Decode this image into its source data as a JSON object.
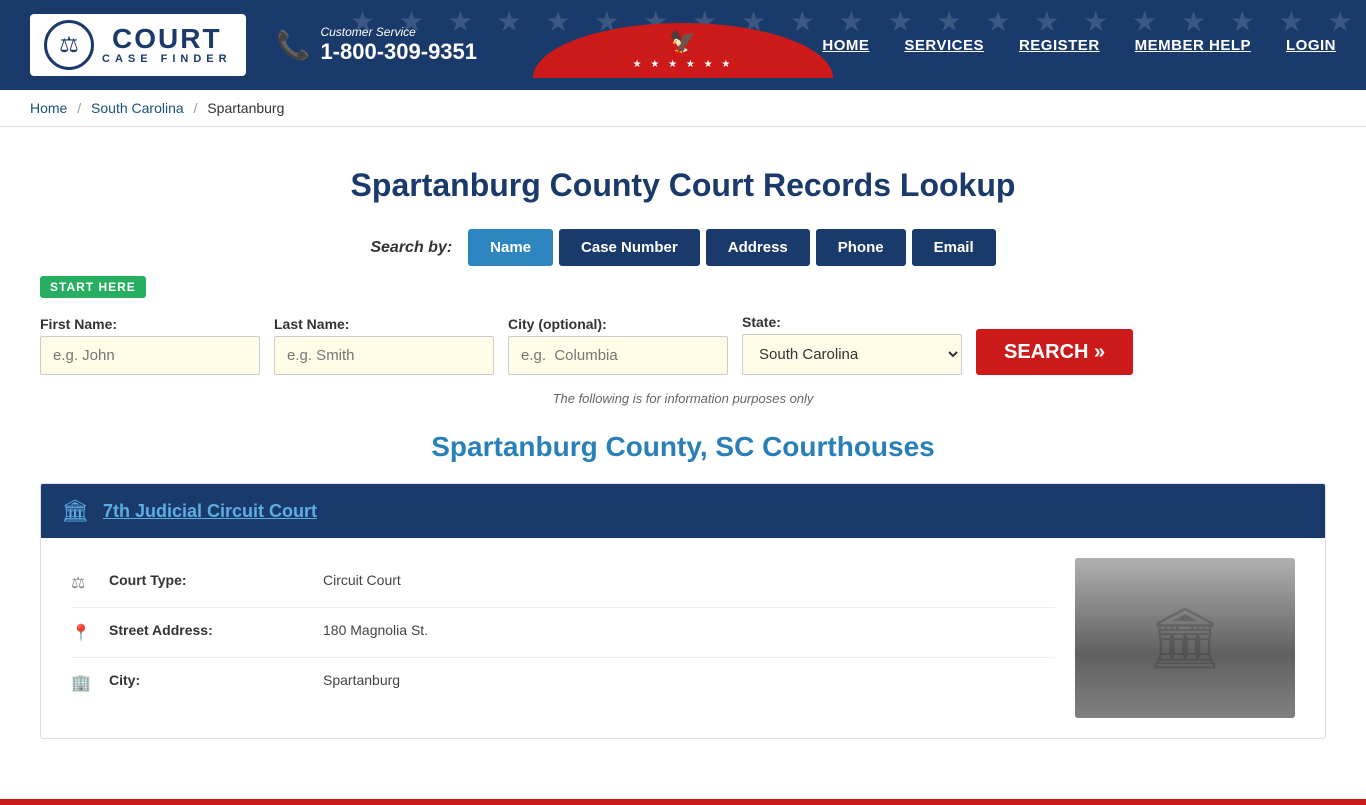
{
  "header": {
    "logo": {
      "emblem_char": "⚖",
      "court_label": "COURT",
      "case_finder_label": "CASE FINDER"
    },
    "phone": {
      "label": "Customer Service",
      "number": "1-800-309-9351"
    },
    "nav": {
      "items": [
        {
          "label": "HOME",
          "id": "home"
        },
        {
          "label": "SERVICES",
          "id": "services"
        },
        {
          "label": "REGISTER",
          "id": "register"
        },
        {
          "label": "MEMBER HELP",
          "id": "member-help"
        },
        {
          "label": "LOGIN",
          "id": "login"
        }
      ]
    }
  },
  "breadcrumb": {
    "home": "Home",
    "state": "South Carolina",
    "county": "Spartanburg"
  },
  "search": {
    "page_title": "Spartanburg County Court Records Lookup",
    "search_by_label": "Search by:",
    "tabs": [
      {
        "label": "Name",
        "active": true
      },
      {
        "label": "Case Number",
        "active": false
      },
      {
        "label": "Address",
        "active": false
      },
      {
        "label": "Phone",
        "active": false
      },
      {
        "label": "Email",
        "active": false
      }
    ],
    "start_here_label": "START HERE",
    "fields": {
      "first_name_label": "First Name:",
      "first_name_placeholder": "e.g. John",
      "last_name_label": "Last Name:",
      "last_name_placeholder": "e.g. Smith",
      "city_label": "City (optional):",
      "city_placeholder": "e.g.  Columbia",
      "state_label": "State:",
      "state_value": "South Carolina"
    },
    "search_button": "SEARCH »",
    "disclaimer": "The following is for information purposes only"
  },
  "courthouses": {
    "section_title": "Spartanburg County, SC Courthouses",
    "courts": [
      {
        "name": "7th Judicial Circuit Court",
        "court_type_label": "Court Type:",
        "court_type_value": "Circuit Court",
        "street_label": "Street Address:",
        "street_value": "180 Magnolia St.",
        "city_label": "City:",
        "city_value": "Spartanburg"
      }
    ]
  }
}
